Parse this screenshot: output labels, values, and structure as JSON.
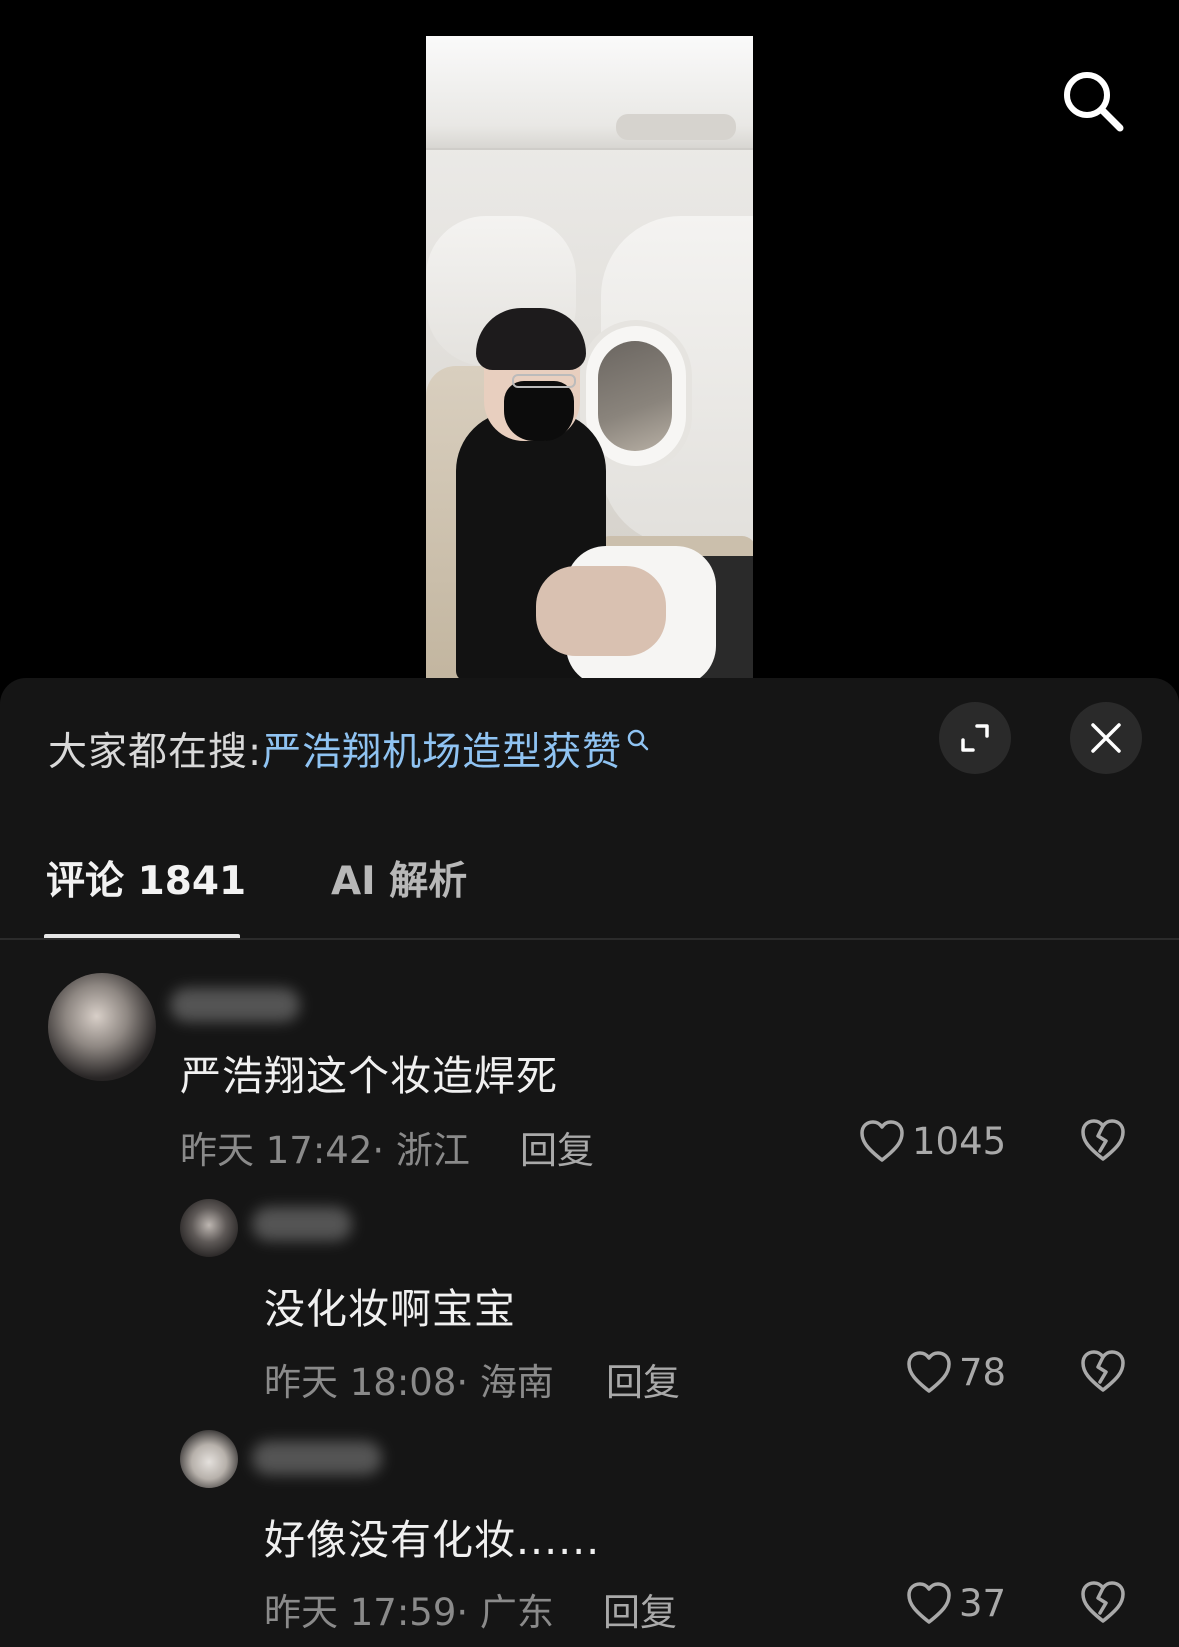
{
  "search_suggestion": {
    "label": "大家都在搜:",
    "query": "严浩翔机场造型获赞"
  },
  "tabs": [
    {
      "label": "评论 1841",
      "active": true
    },
    {
      "label": "AI 解析",
      "active": false
    }
  ],
  "comments": [
    {
      "text": "严浩翔这个妆造焊死",
      "meta": "昨天 17:42· 浙江",
      "reply": "回复",
      "likes": "1045"
    },
    {
      "text": "没化妆啊宝宝",
      "meta": "昨天 18:08· 海南",
      "reply": "回复",
      "likes": "78"
    },
    {
      "text": "好像没有化妆......",
      "meta": "昨天 17:59· 广东",
      "reply": "回复",
      "likes": "37"
    }
  ],
  "colors": {
    "accent_link": "#8fc3f2",
    "sheet_bg": "#151515",
    "page_bg": "#000000"
  },
  "icons": [
    "search-icon",
    "expand-icon",
    "close-icon",
    "heart-icon",
    "broken-heart-icon"
  ]
}
